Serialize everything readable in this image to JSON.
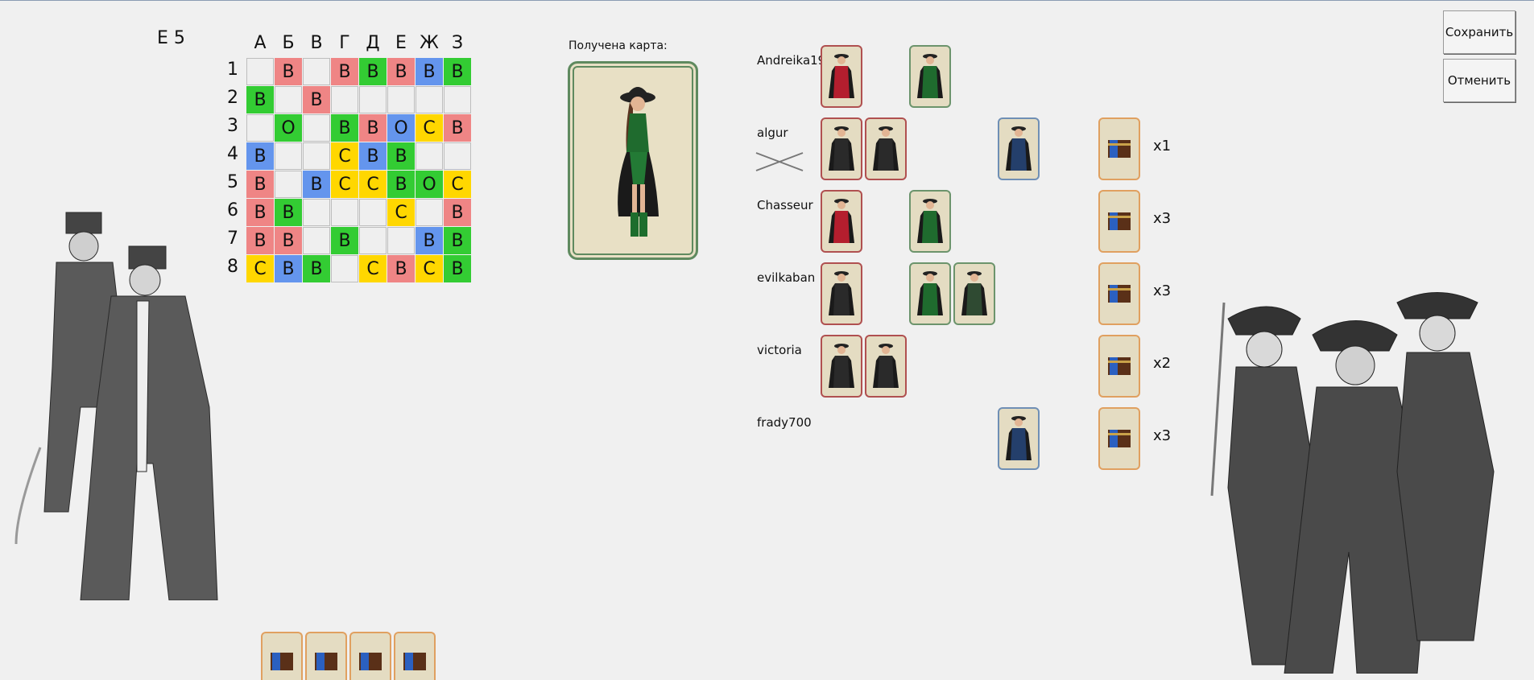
{
  "status": {
    "cell": "Е 5"
  },
  "board": {
    "columns": [
      "А",
      "Б",
      "В",
      "Г",
      "Д",
      "Е",
      "Ж",
      "З"
    ],
    "rows": [
      "1",
      "2",
      "3",
      "4",
      "5",
      "6",
      "7",
      "8"
    ],
    "cells": [
      [
        {
          "t": "",
          "c": ""
        },
        {
          "t": "В",
          "c": "r"
        },
        {
          "t": "",
          "c": ""
        },
        {
          "t": "В",
          "c": "r"
        },
        {
          "t": "В",
          "c": "g"
        },
        {
          "t": "В",
          "c": "r"
        },
        {
          "t": "В",
          "c": "b"
        },
        {
          "t": "В",
          "c": "g"
        }
      ],
      [
        {
          "t": "В",
          "c": "g"
        },
        {
          "t": "",
          "c": ""
        },
        {
          "t": "В",
          "c": "r"
        },
        {
          "t": "",
          "c": ""
        },
        {
          "t": "",
          "c": ""
        },
        {
          "t": "",
          "c": ""
        },
        {
          "t": "",
          "c": ""
        },
        {
          "t": "",
          "c": ""
        }
      ],
      [
        {
          "t": "",
          "c": ""
        },
        {
          "t": "О",
          "c": "g"
        },
        {
          "t": "",
          "c": ""
        },
        {
          "t": "В",
          "c": "g"
        },
        {
          "t": "В",
          "c": "r"
        },
        {
          "t": "О",
          "c": "b"
        },
        {
          "t": "С",
          "c": "y"
        },
        {
          "t": "В",
          "c": "r"
        }
      ],
      [
        {
          "t": "В",
          "c": "b"
        },
        {
          "t": "",
          "c": ""
        },
        {
          "t": "",
          "c": ""
        },
        {
          "t": "С",
          "c": "y"
        },
        {
          "t": "В",
          "c": "b"
        },
        {
          "t": "В",
          "c": "g"
        },
        {
          "t": "",
          "c": ""
        },
        {
          "t": "",
          "c": ""
        }
      ],
      [
        {
          "t": "В",
          "c": "r"
        },
        {
          "t": "",
          "c": ""
        },
        {
          "t": "В",
          "c": "b"
        },
        {
          "t": "С",
          "c": "y"
        },
        {
          "t": "С",
          "c": "y"
        },
        {
          "t": "В",
          "c": "g"
        },
        {
          "t": "О",
          "c": "g"
        },
        {
          "t": "С",
          "c": "y"
        }
      ],
      [
        {
          "t": "В",
          "c": "r"
        },
        {
          "t": "В",
          "c": "g"
        },
        {
          "t": "",
          "c": ""
        },
        {
          "t": "",
          "c": ""
        },
        {
          "t": "",
          "c": ""
        },
        {
          "t": "С",
          "c": "y"
        },
        {
          "t": "",
          "c": ""
        },
        {
          "t": "В",
          "c": "r"
        }
      ],
      [
        {
          "t": "В",
          "c": "r"
        },
        {
          "t": "В",
          "c": "r"
        },
        {
          "t": "",
          "c": ""
        },
        {
          "t": "В",
          "c": "g"
        },
        {
          "t": "",
          "c": ""
        },
        {
          "t": "",
          "c": ""
        },
        {
          "t": "В",
          "c": "b"
        },
        {
          "t": "В",
          "c": "g"
        }
      ],
      [
        {
          "t": "С",
          "c": "y"
        },
        {
          "t": "В",
          "c": "b"
        },
        {
          "t": "В",
          "c": "g"
        },
        {
          "t": "",
          "c": ""
        },
        {
          "t": "С",
          "c": "y"
        },
        {
          "t": "В",
          "c": "r"
        },
        {
          "t": "С",
          "c": "y"
        },
        {
          "t": "В",
          "c": "g"
        }
      ]
    ]
  },
  "received": {
    "label": "Получена карта:",
    "card": "green-pirate-woman"
  },
  "players": [
    {
      "name": "Andreika197",
      "cards": [
        {
          "slot": 0,
          "kind": "red-woman",
          "border": "red"
        },
        {
          "slot": 2,
          "kind": "green-woman",
          "border": "green"
        }
      ],
      "chest": false,
      "mult": ""
    },
    {
      "name": "algur",
      "swords": true,
      "cards": [
        {
          "slot": 0,
          "kind": "red-man",
          "border": "red"
        },
        {
          "slot": 1,
          "kind": "red-man",
          "border": "red"
        },
        {
          "slot": 4,
          "kind": "blue-man",
          "border": "blue"
        }
      ],
      "chest": true,
      "mult": "x1"
    },
    {
      "name": "Chasseur",
      "cards": [
        {
          "slot": 0,
          "kind": "red-woman",
          "border": "red"
        },
        {
          "slot": 2,
          "kind": "green-woman",
          "border": "green"
        }
      ],
      "chest": true,
      "mult": "x3"
    },
    {
      "name": "evilkaban",
      "cards": [
        {
          "slot": 0,
          "kind": "red-man",
          "border": "red"
        },
        {
          "slot": 2,
          "kind": "green-woman",
          "border": "green"
        },
        {
          "slot": 3,
          "kind": "green-man",
          "border": "green"
        }
      ],
      "chest": true,
      "mult": "x3"
    },
    {
      "name": "victoria",
      "cards": [
        {
          "slot": 0,
          "kind": "red-man",
          "border": "red"
        },
        {
          "slot": 1,
          "kind": "red-man",
          "border": "red"
        }
      ],
      "chest": true,
      "mult": "x2"
    },
    {
      "name": "frady700",
      "cards": [
        {
          "slot": 4,
          "kind": "blue-man",
          "border": "blue"
        }
      ],
      "chest": true,
      "mult": "x3"
    }
  ],
  "buttons": {
    "save": "Сохранить",
    "cancel": "Отменить"
  },
  "hand": {
    "count": 4,
    "kind": "chest"
  }
}
